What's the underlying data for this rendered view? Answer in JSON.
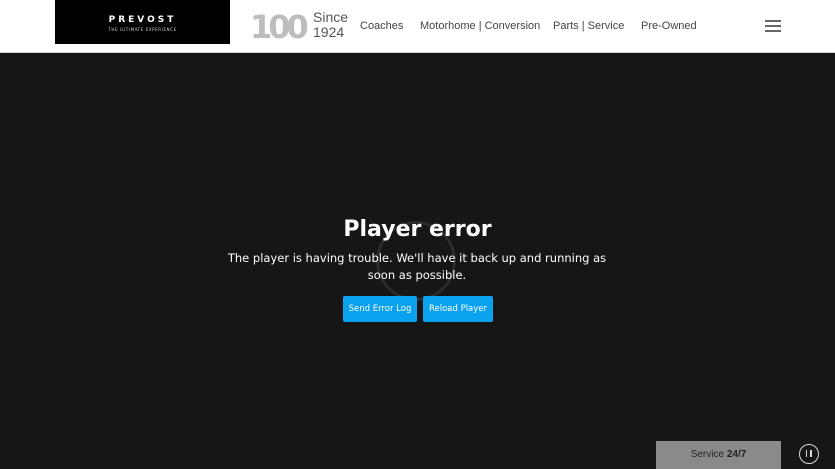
{
  "header": {
    "brand_name": "PREVOST",
    "brand_tagline": "THE ULTIMATE EXPERIENCE",
    "anniversary_number": "100",
    "anniversary_line1": "Since",
    "anniversary_line2": "1924",
    "nav": [
      {
        "label": "Coaches"
      },
      {
        "label": "Motorhome | Conversion"
      },
      {
        "label": "Parts | Service"
      },
      {
        "label": "Pre-Owned"
      }
    ],
    "menu_icon": "hamburger-menu-icon"
  },
  "player": {
    "error_title": "Player error",
    "error_message": "The player is having trouble. We'll have it back up and running as soon as possible.",
    "send_error_log_label": "Send Error Log",
    "reload_player_label": "Reload Player",
    "button_color": "#0aa1ef"
  },
  "footer": {
    "service_label": "Service",
    "service_hours": "24/7",
    "pause_icon": "pause-icon"
  }
}
